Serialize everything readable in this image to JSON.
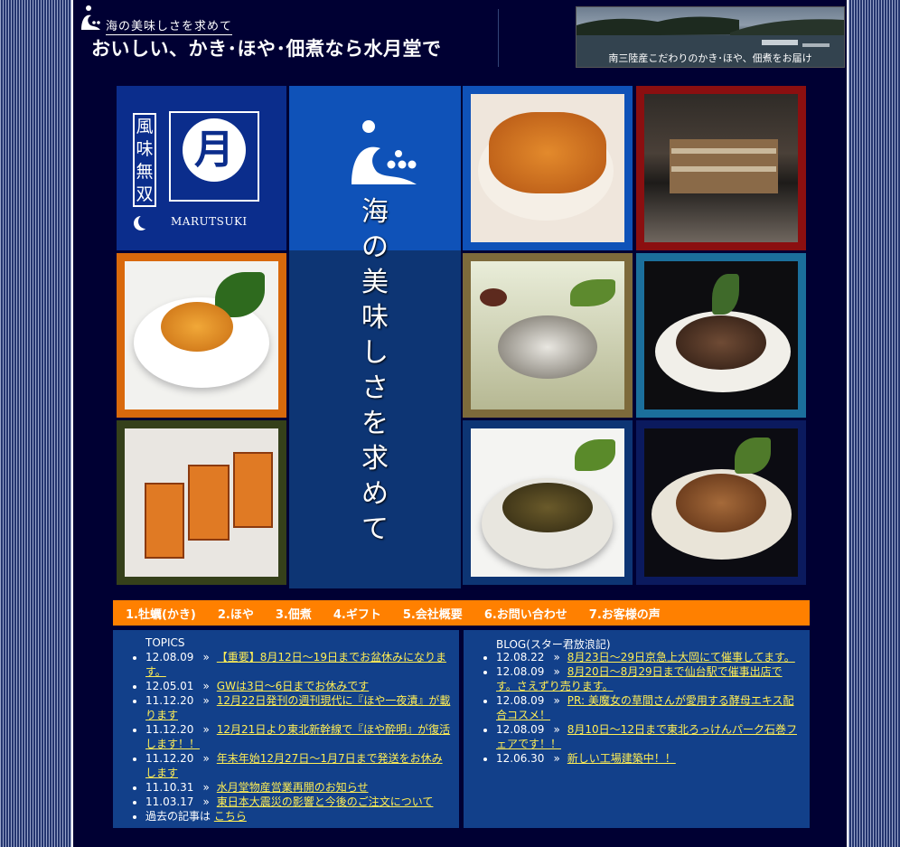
{
  "header": {
    "tagline": "海の美味しさを求めて",
    "title": "おいしい、かき･ほや･佃煮なら水月堂で",
    "banner_caption": "南三陸産こだわりのかき･ほや、佃煮をお届け"
  },
  "brand": {
    "vertical_text": "風味無双",
    "circle_char": "月",
    "name": "MARUTSUKI"
  },
  "slogan": "海の美味しさを求めて",
  "nav": {
    "items": [
      "1.牡蠣(かき)",
      "2.ほや",
      "3.佃煮",
      "4.ギフト",
      "5.会社概要",
      "6.お問い合わせ",
      "7.お客様の声"
    ]
  },
  "topics": {
    "heading": "TOPICS",
    "items": [
      {
        "date": "12.08.09",
        "text": "【重要】8月12日～19日までお盆休みになります。"
      },
      {
        "date": "12.05.01",
        "text": "GWは3日～6日までお休みです"
      },
      {
        "date": "11.12.20",
        "text": "12月22日発刊の週刊現代に『ほや一夜漬』が載ります"
      },
      {
        "date": "11.12.20",
        "text": "12月21日より東北新幹線で『ほや酔明』が復活します！！"
      },
      {
        "date": "11.12.20",
        "text": "年末年始12月27日～1月7日まで発送をお休みします"
      },
      {
        "date": "11.10.31",
        "text": "水月堂物産営業再開のお知らせ"
      },
      {
        "date": "11.03.17",
        "text": "東日本大震災の影響と今後のご注文について"
      }
    ],
    "archive_label": "過去の記事は",
    "archive_link": "こちら"
  },
  "blog": {
    "heading": "BLOG(スター君放浪記)",
    "items": [
      {
        "date": "12.08.22",
        "text": "8月23日～29日京急上大岡にて催事してます。"
      },
      {
        "date": "12.08.09",
        "text": "8月20日～8月29日まで仙台駅で催事出店です。さえずり売ります。"
      },
      {
        "date": "12.08.09",
        "text": "PR: 美魔女の草間さんが愛用する酵母エキス配合コスメ！"
      },
      {
        "date": "12.08.09",
        "text": "8月10日～12日まで東北ろっけんパーク石巻フェアです！！"
      },
      {
        "date": "12.06.30",
        "text": "新しい工場建築中！！"
      }
    ]
  },
  "colors": {
    "page_bg": "#000033",
    "nav_bg": "#ff8000",
    "panel_bg": "#12408a",
    "link": "#ffee55"
  }
}
